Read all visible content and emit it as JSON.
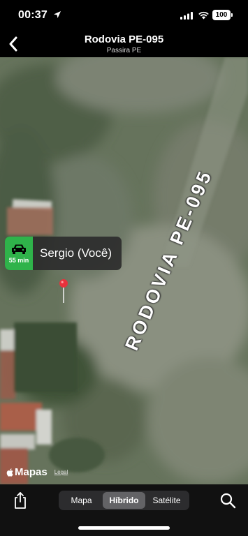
{
  "status_bar": {
    "time": "00:37",
    "battery": "100"
  },
  "header": {
    "title": "Rodovia PE-095",
    "subtitle": "Passira PE"
  },
  "map": {
    "road_label": "RODOVIA PE-095",
    "eta": {
      "time": "55 min",
      "name": "Sergio (Você)",
      "badge_color": "#2fb34a"
    },
    "pin_color": "#e8323c",
    "attribution": {
      "brand": "Mapas",
      "legal": "Legal"
    }
  },
  "toolbar": {
    "segments": [
      {
        "label": "Mapa",
        "selected": false
      },
      {
        "label": "Híbrido",
        "selected": true
      },
      {
        "label": "Satélite",
        "selected": false
      }
    ],
    "icons": [
      "share-icon",
      "search-icon"
    ]
  }
}
